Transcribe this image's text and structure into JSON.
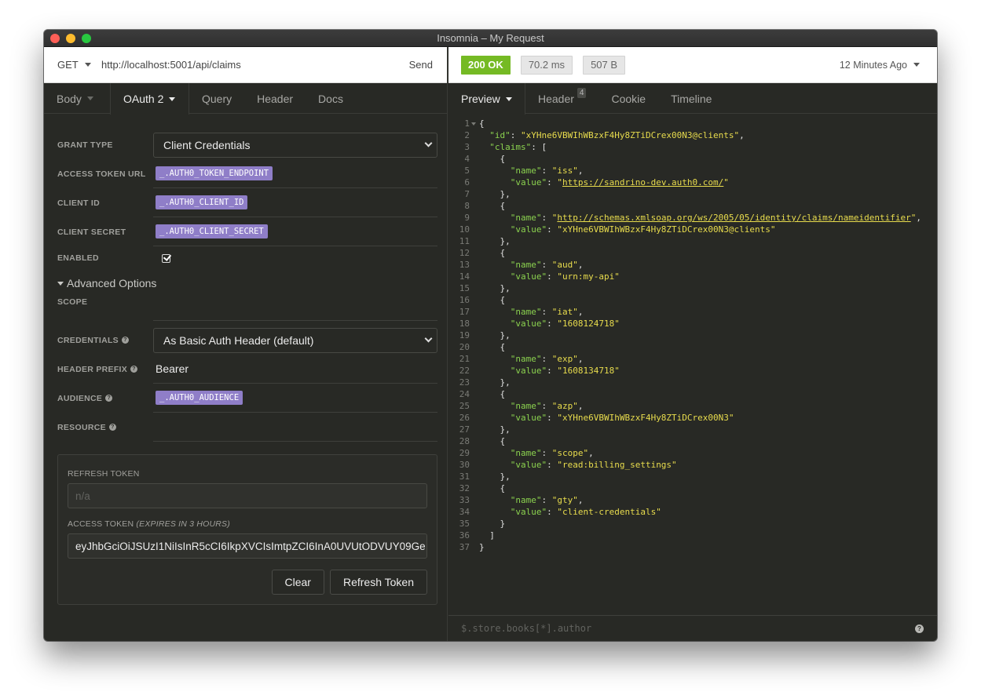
{
  "window": {
    "title": "Insomnia – My Request"
  },
  "request": {
    "method": "GET",
    "url": "http://localhost:5001/api/claims",
    "send_label": "Send"
  },
  "response": {
    "status": "200 OK",
    "time": "70.2 ms",
    "size": "507 B",
    "time_ago": "12 Minutes Ago",
    "status_color": "#75ba24"
  },
  "request_tabs": [
    {
      "label": "Body"
    },
    {
      "label": "OAuth 2"
    },
    {
      "label": "Query"
    },
    {
      "label": "Header"
    },
    {
      "label": "Docs"
    }
  ],
  "response_tabs": [
    {
      "label": "Preview"
    },
    {
      "label": "Header",
      "count": "4"
    },
    {
      "label": "Cookie"
    },
    {
      "label": "Timeline"
    }
  ],
  "oauth": {
    "grant_type_label": "GRANT TYPE",
    "grant_type_value": "Client Credentials",
    "access_token_url_label": "ACCESS TOKEN URL",
    "access_token_url_value": "_.AUTH0_TOKEN_ENDPOINT",
    "client_id_label": "CLIENT ID",
    "client_id_value": "_.AUTH0_CLIENT_ID",
    "client_secret_label": "CLIENT SECRET",
    "client_secret_value": "_.AUTH0_CLIENT_SECRET",
    "enabled_label": "ENABLED",
    "enabled_checked": true,
    "advanced_label": "Advanced Options",
    "scope_label": "SCOPE",
    "scope_value": "",
    "credentials_label": "CREDENTIALS",
    "credentials_value": "As Basic Auth Header (default)",
    "header_prefix_label": "HEADER PREFIX",
    "header_prefix_value": "Bearer",
    "audience_label": "AUDIENCE",
    "audience_value": "_.AUTH0_AUDIENCE",
    "resource_label": "RESOURCE",
    "resource_value": "",
    "var_tag_color": "#8f7ec8"
  },
  "tokens": {
    "refresh_label": "REFRESH TOKEN",
    "refresh_placeholder": "n/a",
    "access_label": "ACCESS TOKEN",
    "access_expiry": "(EXPIRES IN 3 HOURS)",
    "access_value": "eyJhbGciOiJSUzI1NiIsInR5cCI6IkpXVCIsImtpZCI6InA0UVUtODVUY09Ge",
    "clear_label": "Clear",
    "refresh_button_label": "Refresh Token"
  },
  "preview": {
    "lines": [
      [
        {
          "t": "p",
          "v": "{"
        }
      ],
      [
        {
          "t": "p",
          "v": "  "
        },
        {
          "t": "k",
          "v": "\"id\""
        },
        {
          "t": "p",
          "v": ": "
        },
        {
          "t": "s",
          "v": "\"xYHne6VBWIhWBzxF4Hy8ZTiDCrex00N3@clients\""
        },
        {
          "t": "p",
          "v": ","
        }
      ],
      [
        {
          "t": "p",
          "v": "  "
        },
        {
          "t": "k",
          "v": "\"claims\""
        },
        {
          "t": "p",
          "v": ": ["
        }
      ],
      [
        {
          "t": "p",
          "v": "    {"
        }
      ],
      [
        {
          "t": "p",
          "v": "      "
        },
        {
          "t": "k",
          "v": "\"name\""
        },
        {
          "t": "p",
          "v": ": "
        },
        {
          "t": "s",
          "v": "\"iss\""
        },
        {
          "t": "p",
          "v": ","
        }
      ],
      [
        {
          "t": "p",
          "v": "      "
        },
        {
          "t": "k",
          "v": "\"value\""
        },
        {
          "t": "p",
          "v": ": "
        },
        {
          "t": "s",
          "v": "\""
        },
        {
          "t": "su",
          "v": "https://sandrino-dev.auth0.com/"
        },
        {
          "t": "s",
          "v": "\""
        }
      ],
      [
        {
          "t": "p",
          "v": "    },"
        }
      ],
      [
        {
          "t": "p",
          "v": "    {"
        }
      ],
      [
        {
          "t": "p",
          "v": "      "
        },
        {
          "t": "k",
          "v": "\"name\""
        },
        {
          "t": "p",
          "v": ": "
        },
        {
          "t": "s",
          "v": "\""
        },
        {
          "t": "su",
          "v": "http://schemas.xmlsoap.org/ws/2005/05/identity/claims/nameidentifier"
        },
        {
          "t": "s",
          "v": "\""
        },
        {
          "t": "p",
          "v": ","
        }
      ],
      [
        {
          "t": "p",
          "v": "      "
        },
        {
          "t": "k",
          "v": "\"value\""
        },
        {
          "t": "p",
          "v": ": "
        },
        {
          "t": "s",
          "v": "\"xYHne6VBWIhWBzxF4Hy8ZTiDCrex00N3@clients\""
        }
      ],
      [
        {
          "t": "p",
          "v": "    },"
        }
      ],
      [
        {
          "t": "p",
          "v": "    {"
        }
      ],
      [
        {
          "t": "p",
          "v": "      "
        },
        {
          "t": "k",
          "v": "\"name\""
        },
        {
          "t": "p",
          "v": ": "
        },
        {
          "t": "s",
          "v": "\"aud\""
        },
        {
          "t": "p",
          "v": ","
        }
      ],
      [
        {
          "t": "p",
          "v": "      "
        },
        {
          "t": "k",
          "v": "\"value\""
        },
        {
          "t": "p",
          "v": ": "
        },
        {
          "t": "s",
          "v": "\"urn:my-api\""
        }
      ],
      [
        {
          "t": "p",
          "v": "    },"
        }
      ],
      [
        {
          "t": "p",
          "v": "    {"
        }
      ],
      [
        {
          "t": "p",
          "v": "      "
        },
        {
          "t": "k",
          "v": "\"name\""
        },
        {
          "t": "p",
          "v": ": "
        },
        {
          "t": "s",
          "v": "\"iat\""
        },
        {
          "t": "p",
          "v": ","
        }
      ],
      [
        {
          "t": "p",
          "v": "      "
        },
        {
          "t": "k",
          "v": "\"value\""
        },
        {
          "t": "p",
          "v": ": "
        },
        {
          "t": "s",
          "v": "\"1608124718\""
        }
      ],
      [
        {
          "t": "p",
          "v": "    },"
        }
      ],
      [
        {
          "t": "p",
          "v": "    {"
        }
      ],
      [
        {
          "t": "p",
          "v": "      "
        },
        {
          "t": "k",
          "v": "\"name\""
        },
        {
          "t": "p",
          "v": ": "
        },
        {
          "t": "s",
          "v": "\"exp\""
        },
        {
          "t": "p",
          "v": ","
        }
      ],
      [
        {
          "t": "p",
          "v": "      "
        },
        {
          "t": "k",
          "v": "\"value\""
        },
        {
          "t": "p",
          "v": ": "
        },
        {
          "t": "s",
          "v": "\"1608134718\""
        }
      ],
      [
        {
          "t": "p",
          "v": "    },"
        }
      ],
      [
        {
          "t": "p",
          "v": "    {"
        }
      ],
      [
        {
          "t": "p",
          "v": "      "
        },
        {
          "t": "k",
          "v": "\"name\""
        },
        {
          "t": "p",
          "v": ": "
        },
        {
          "t": "s",
          "v": "\"azp\""
        },
        {
          "t": "p",
          "v": ","
        }
      ],
      [
        {
          "t": "p",
          "v": "      "
        },
        {
          "t": "k",
          "v": "\"value\""
        },
        {
          "t": "p",
          "v": ": "
        },
        {
          "t": "s",
          "v": "\"xYHne6VBWIhWBzxF4Hy8ZTiDCrex00N3\""
        }
      ],
      [
        {
          "t": "p",
          "v": "    },"
        }
      ],
      [
        {
          "t": "p",
          "v": "    {"
        }
      ],
      [
        {
          "t": "p",
          "v": "      "
        },
        {
          "t": "k",
          "v": "\"name\""
        },
        {
          "t": "p",
          "v": ": "
        },
        {
          "t": "s",
          "v": "\"scope\""
        },
        {
          "t": "p",
          "v": ","
        }
      ],
      [
        {
          "t": "p",
          "v": "      "
        },
        {
          "t": "k",
          "v": "\"value\""
        },
        {
          "t": "p",
          "v": ": "
        },
        {
          "t": "s",
          "v": "\"read:billing_settings\""
        }
      ],
      [
        {
          "t": "p",
          "v": "    },"
        }
      ],
      [
        {
          "t": "p",
          "v": "    {"
        }
      ],
      [
        {
          "t": "p",
          "v": "      "
        },
        {
          "t": "k",
          "v": "\"name\""
        },
        {
          "t": "p",
          "v": ": "
        },
        {
          "t": "s",
          "v": "\"gty\""
        },
        {
          "t": "p",
          "v": ","
        }
      ],
      [
        {
          "t": "p",
          "v": "      "
        },
        {
          "t": "k",
          "v": "\"value\""
        },
        {
          "t": "p",
          "v": ": "
        },
        {
          "t": "s",
          "v": "\"client-credentials\""
        }
      ],
      [
        {
          "t": "p",
          "v": "    }"
        }
      ],
      [
        {
          "t": "p",
          "v": "  ]"
        }
      ],
      [
        {
          "t": "p",
          "v": "}"
        }
      ]
    ],
    "filter_placeholder": "$.store.books[*].author",
    "colors": {
      "key": "#8bd24f",
      "string": "#e8dc4d"
    }
  }
}
